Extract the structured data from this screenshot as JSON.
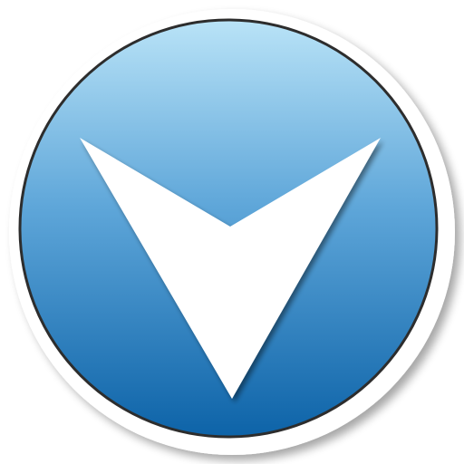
{
  "icon": {
    "name": "chevron-down-icon",
    "colors": {
      "gradient_top": "#b9e3f7",
      "gradient_mid": "#5ea6d9",
      "gradient_bottom": "#0d63a8",
      "chevron": "#ffffff",
      "outer_ring": "#ffffff",
      "outline": "#2d2d2d"
    }
  }
}
